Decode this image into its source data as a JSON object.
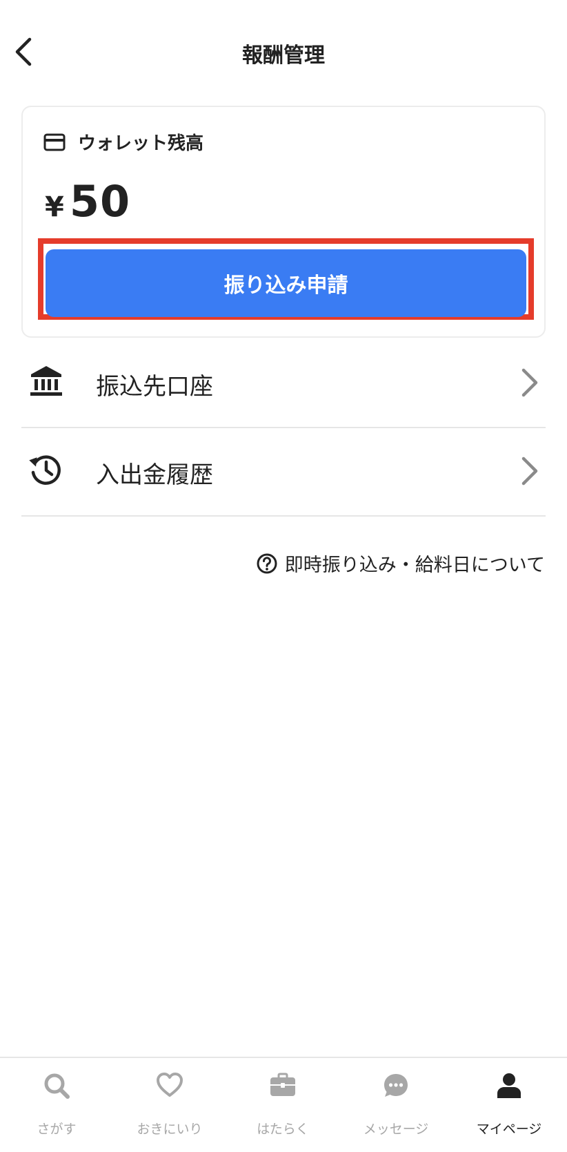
{
  "header": {
    "title": "報酬管理"
  },
  "wallet": {
    "label": "ウォレット残高",
    "currency": "¥",
    "amount": "50",
    "button_label": "振り込み申請"
  },
  "menu": [
    {
      "label": "振込先口座",
      "icon": "bank-icon"
    },
    {
      "label": "入出金履歴",
      "icon": "history-icon"
    }
  ],
  "help": {
    "text": "即時振り込み・給料日について",
    "icon": "help-circle-icon"
  },
  "tabs": [
    {
      "label": "さがす",
      "icon": "search-icon",
      "active": false
    },
    {
      "label": "おきにいり",
      "icon": "heart-icon",
      "active": false
    },
    {
      "label": "はたらく",
      "icon": "briefcase-icon",
      "active": false
    },
    {
      "label": "メッセージ",
      "icon": "chat-bubble-icon",
      "active": false
    },
    {
      "label": "マイページ",
      "icon": "person-icon",
      "active": true
    }
  ],
  "colors": {
    "primary": "#3a7cf3",
    "highlight": "#e53c2b",
    "inactive": "#a7a7a7",
    "text": "#222222"
  }
}
